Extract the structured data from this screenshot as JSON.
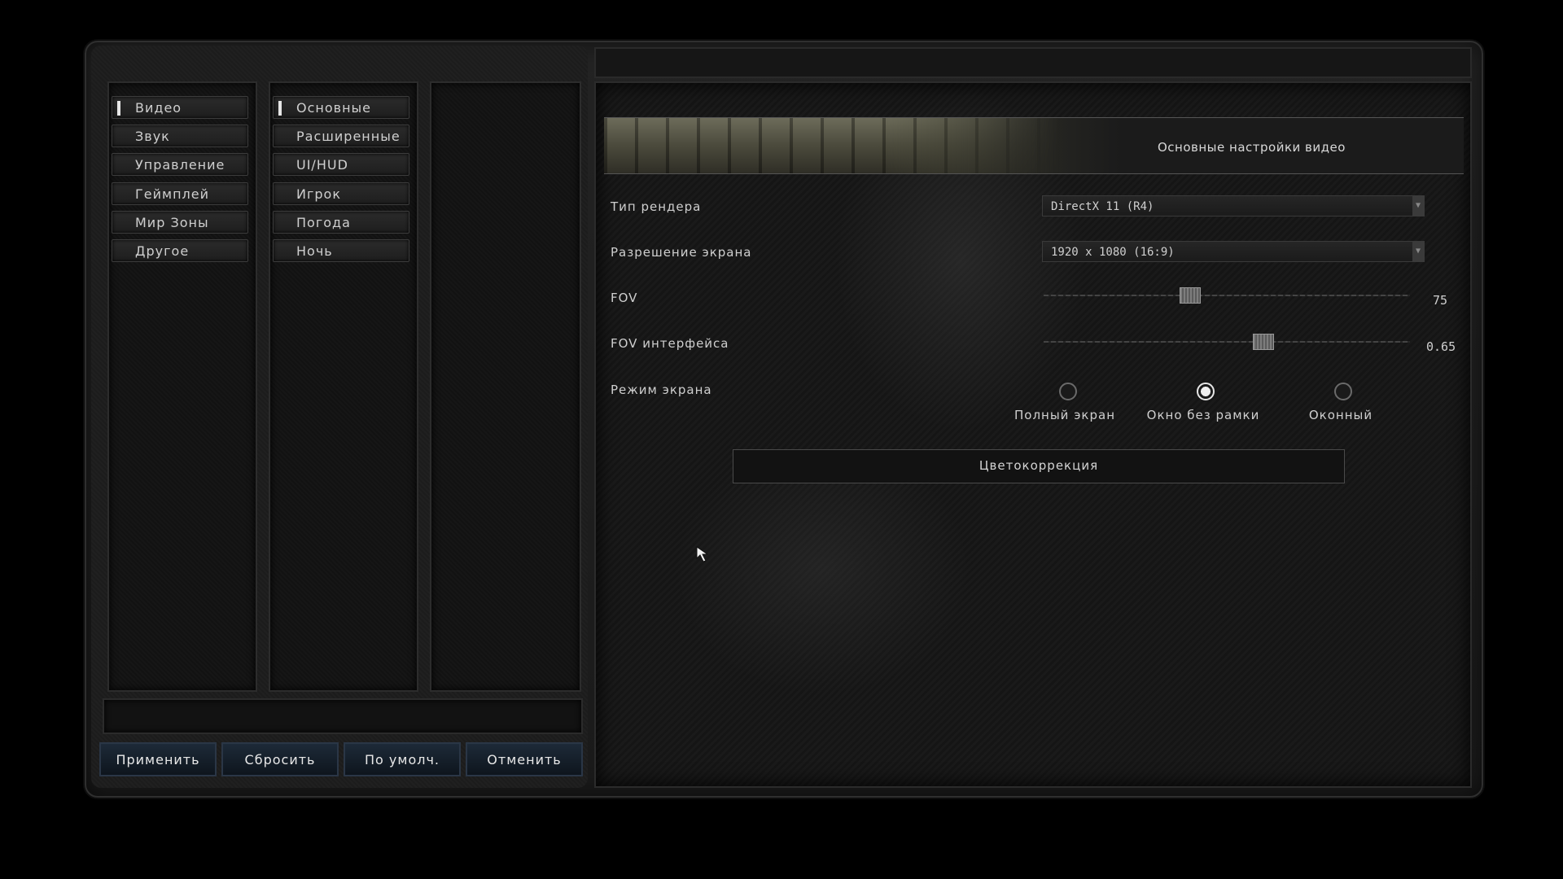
{
  "categories": [
    {
      "label": "Видео",
      "active": true
    },
    {
      "label": "Звук",
      "active": false
    },
    {
      "label": "Управление",
      "active": false
    },
    {
      "label": "Геймплей",
      "active": false
    },
    {
      "label": "Мир Зоны",
      "active": false
    },
    {
      "label": "Другое",
      "active": false
    }
  ],
  "subcategories": [
    {
      "label": "Основные",
      "active": true
    },
    {
      "label": "Расширенные",
      "active": false
    },
    {
      "label": "UI/HUD",
      "active": false
    },
    {
      "label": "Игрок",
      "active": false
    },
    {
      "label": "Погода",
      "active": false
    },
    {
      "label": "Ночь",
      "active": false
    }
  ],
  "buttons": {
    "apply": "Применить",
    "reset": "Сбросить",
    "default": "По умолч.",
    "cancel": "Отменить"
  },
  "banner": {
    "title": "Основные настройки видео"
  },
  "settings": {
    "render": {
      "label": "Тип рендера",
      "value": "DirectX 11 (R4)"
    },
    "resolution": {
      "label": "Разрешение экрана",
      "value": "1920 x 1080 (16:9)"
    },
    "fov": {
      "label": "FOV",
      "value": "75",
      "fraction": 0.4
    },
    "hud_fov": {
      "label": "FOV интерфейса",
      "value": "0.65",
      "fraction": 0.6
    },
    "screen_mode": {
      "label": "Режим экрана",
      "options": [
        {
          "label": "Полный экран",
          "checked": false
        },
        {
          "label": "Окно без рамки",
          "checked": true
        },
        {
          "label": "Оконный",
          "checked": false
        }
      ]
    }
  },
  "color_correction": {
    "label": "Цветокоррекция"
  },
  "icons": {
    "dropdown": "chevron-down-icon",
    "cursor": "mouse-cursor-icon"
  }
}
